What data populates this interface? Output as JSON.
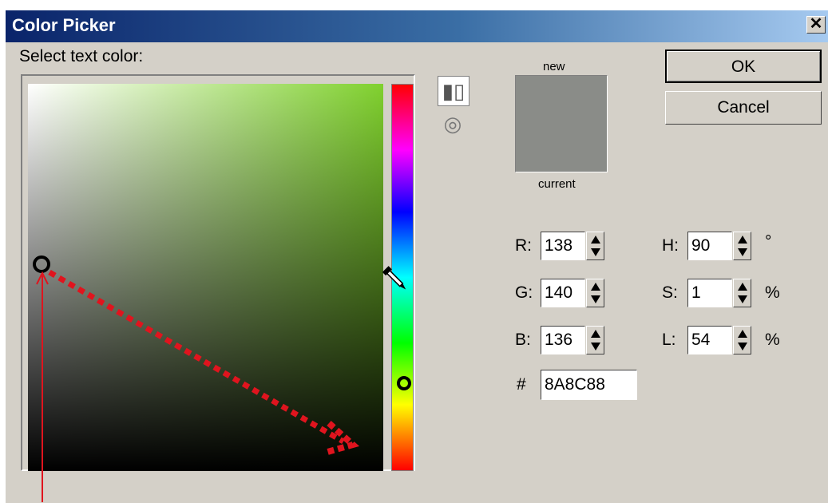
{
  "window": {
    "title": "Color Picker",
    "close_glyph": "✕"
  },
  "prompt": "Select text color:",
  "preview": {
    "new_label": "new",
    "current_label": "current",
    "color": "#8A8C88"
  },
  "rgb": {
    "r": {
      "label": "R:",
      "value": "138"
    },
    "g": {
      "label": "G:",
      "value": "140"
    },
    "b": {
      "label": "B:",
      "value": "136"
    }
  },
  "hsl": {
    "h": {
      "label": "H:",
      "value": "90",
      "unit": "°"
    },
    "s": {
      "label": "S:",
      "value": "1",
      "unit": "%"
    },
    "l": {
      "label": "L:",
      "value": "54",
      "unit": "%"
    }
  },
  "hex": {
    "label": "#",
    "value": "8A8C88"
  },
  "buttons": {
    "ok": "OK",
    "cancel": "Cancel"
  },
  "icons": {
    "mode_slider": "slider-mode-icon",
    "mode_wheel": "wheel-mode-icon",
    "eyedropper": "eyedropper-icon"
  },
  "colors": {
    "field_hue": "#80D12E",
    "annotation": "#E0141E"
  }
}
